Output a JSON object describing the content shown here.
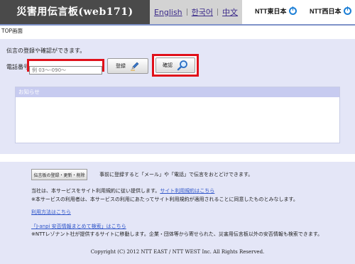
{
  "header": {
    "title": "災害用伝言板(web171)",
    "languages": [
      {
        "label": "English"
      },
      {
        "label": "한국어"
      },
      {
        "label": "中文"
      }
    ],
    "logos": [
      {
        "label": "NTT東日本"
      },
      {
        "label": "NTT西日本"
      }
    ],
    "accent_color": "#7f92c9"
  },
  "breadcrumb": "TOP画面",
  "main": {
    "intro": "伝言の登録や確認ができます。",
    "phone_label": "電話番号",
    "phone_placeholder": "例 03〜-090〜",
    "register_label": "登録",
    "confirm_label": "確認",
    "notice_heading": "お知らせ",
    "highlight_color": "#e0101a"
  },
  "footer": {
    "reg_button": "伝言板の登録・更新・削除",
    "reg_desc": "事前に登録すると「メール」や「電話」で伝言をおとどけできます。",
    "terms_text": "当社は、本サービスをサイト利用規約に従い提供します。",
    "terms_link": "サイト利用規約はこちら",
    "terms_note": "※本サービスの利用者は、本サービスの利用にあたってサイト利用規約が適用されることに同意したものとみなします。",
    "usage_link": "利用方法はこちら",
    "janpi_link": "「J-anpi 安否情報まとめて検索」はこちら",
    "janpi_note": "※NTTレゾナント社が提供するサイトに移動します。企業・団体等から寄せられた、災害用伝言板以外の安否情報も検索できます。",
    "copyright": "Copyright (C) 2012 NTT EAST / NTT WEST Inc. All Rights Reserved."
  }
}
